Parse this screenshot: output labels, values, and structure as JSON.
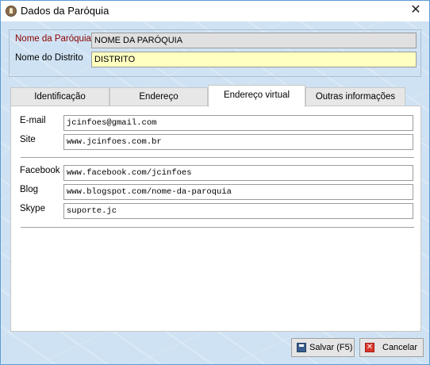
{
  "window": {
    "title": "Dados da Paróquia",
    "close_glyph": "✕"
  },
  "header": {
    "parish_name_label": "Nome da Paróquia",
    "parish_name_value": "NOME DA PARÓQUIA",
    "district_name_label": "Nome do Distrito",
    "district_name_value": "DISTRITO"
  },
  "tabs": [
    {
      "label": "Identificação",
      "active": false
    },
    {
      "label": "Endereço",
      "active": false
    },
    {
      "label": "Endereço virtual",
      "active": true
    },
    {
      "label": "Outras informações",
      "active": false
    }
  ],
  "virtual_address": {
    "email_label": "E-mail",
    "email_value": "jcinfoes@gmail.com",
    "site_label": "Site",
    "site_value": "www.jcinfoes.com.br",
    "facebook_label": "Facebook",
    "facebook_value": "www.facebook.com/jcinfoes",
    "blog_label": "Blog",
    "blog_value": "www.blogspot.com/nome-da-paroquia",
    "skype_label": "Skype",
    "skype_value": "suporte.jc"
  },
  "buttons": {
    "save_label": "Salvar (F5)",
    "cancel_label": "Cancelar",
    "cancel_glyph": "✕"
  },
  "colors": {
    "parish_label_color": "#8b0000",
    "readonly_field_bg": "#e0e0e0",
    "district_field_bg": "#ffffc0",
    "background_blue": "#cfe2f3"
  },
  "icons": {
    "app": "church-icon",
    "save": "floppy-disk-icon",
    "cancel": "red-x-icon"
  }
}
